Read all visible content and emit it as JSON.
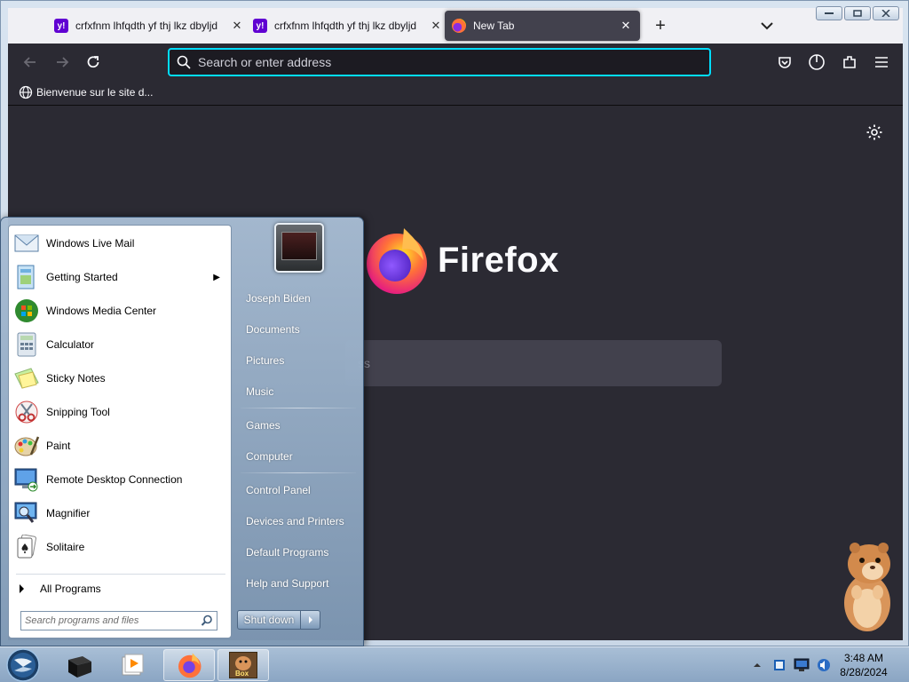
{
  "browser": {
    "tabs": [
      {
        "title": "crfxfnm lhfqdth yf thj lkz dbyljd",
        "favicon": "yahoo-icon",
        "favicon_text": "y!",
        "active": false
      },
      {
        "title": "crfxfnm lhfqdth yf thj lkz dbyljd",
        "favicon": "yahoo-icon",
        "favicon_text": "y!",
        "active": false
      },
      {
        "title": "New Tab",
        "favicon": "firefox-icon",
        "favicon_text": "",
        "active": true
      }
    ],
    "close_glyph": "✕",
    "new_tab_glyph": "+",
    "urlbar": {
      "placeholder": "Search or enter address",
      "value": ""
    },
    "bookmark": {
      "label": "Bienvenue sur le site d..."
    },
    "newtab": {
      "wordmark": "Firefox",
      "search_hint_visible": "ss"
    },
    "colors": {
      "toolbar": "#2b2a33",
      "focus_ring": "#00ddff",
      "tabstrip": "#f0f0f4"
    }
  },
  "start_menu": {
    "programs": [
      {
        "label": "Windows Live Mail",
        "icon": "mail-icon",
        "submenu": false
      },
      {
        "label": "Getting Started",
        "icon": "getting-started-icon",
        "submenu": true
      },
      {
        "label": "Windows Media Center",
        "icon": "media-center-icon",
        "submenu": false
      },
      {
        "label": "Calculator",
        "icon": "calculator-icon",
        "submenu": false
      },
      {
        "label": "Sticky Notes",
        "icon": "sticky-notes-icon",
        "submenu": false
      },
      {
        "label": "Snipping Tool",
        "icon": "scissors-icon",
        "submenu": false
      },
      {
        "label": "Paint",
        "icon": "paint-palette-icon",
        "submenu": false
      },
      {
        "label": "Remote Desktop Connection",
        "icon": "remote-desktop-icon",
        "submenu": false
      },
      {
        "label": "Magnifier",
        "icon": "magnifier-icon",
        "submenu": false
      },
      {
        "label": "Solitaire",
        "icon": "solitaire-icon",
        "submenu": false
      }
    ],
    "all_programs": "All Programs",
    "search_placeholder": "Search programs and files",
    "right_links": [
      {
        "label": "Joseph Biden"
      },
      {
        "label": "Documents"
      },
      {
        "label": "Pictures"
      },
      {
        "label": "Music"
      },
      {
        "label": "Games"
      },
      {
        "label": "Computer"
      },
      {
        "label": "Control Panel"
      },
      {
        "label": "Devices and Printers"
      },
      {
        "label": "Default Programs"
      },
      {
        "label": "Help and Support"
      }
    ],
    "shutdown_label": "Shut down"
  },
  "taskbar": {
    "pinned": [
      "terminal-icon",
      "media-player-icon",
      "firefox-icon",
      "hamster-game-icon"
    ],
    "game_badge": "Box",
    "clock": {
      "time": "3:48 AM",
      "date": "8/28/2024"
    }
  }
}
